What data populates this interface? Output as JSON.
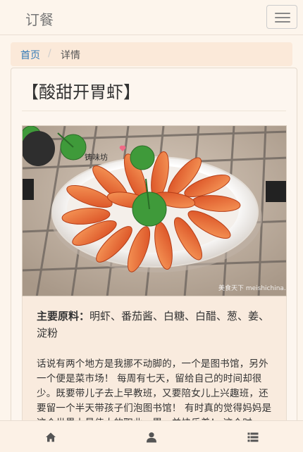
{
  "navbar": {
    "brand": "订餐",
    "menu_icon": "hamburger-menu-icon"
  },
  "breadcrumb": {
    "home": "首页",
    "separator": "/",
    "current": "详情"
  },
  "recipe": {
    "title": "【酸甜开胃虾】",
    "photo": {
      "name": "sweet-sour-shrimp-photo",
      "logo_text": "铸味坊",
      "watermark": "美食天下 meishichina.com"
    },
    "ingredients_label": "主要原料：",
    "ingredients_text": "明虾、番茄酱、白糖、白醋、葱、姜、淀粉",
    "story": "话说有两个地方是我挪不动脚的，一个是图书馆，另外一个便是菜市场！ 每周有七天，留给自己的时间却很少。既要带儿子去上早教班，又要陪女儿上兴趣班，还要留一个半天带孩子们泡图书馆！ 有时真的觉得妈妈是这个世界上最伟大的职业，累，并快乐着！ 这个时"
  },
  "tabbar": {
    "items": [
      {
        "name": "home",
        "icon": "home-icon"
      },
      {
        "name": "user",
        "icon": "user-icon"
      },
      {
        "name": "list",
        "icon": "list-icon"
      }
    ]
  },
  "colors": {
    "background": "#fdf5ec",
    "breadcrumb_bg": "#fbe9d9",
    "link": "#337ab7",
    "text": "#333333",
    "icon": "#555555"
  }
}
